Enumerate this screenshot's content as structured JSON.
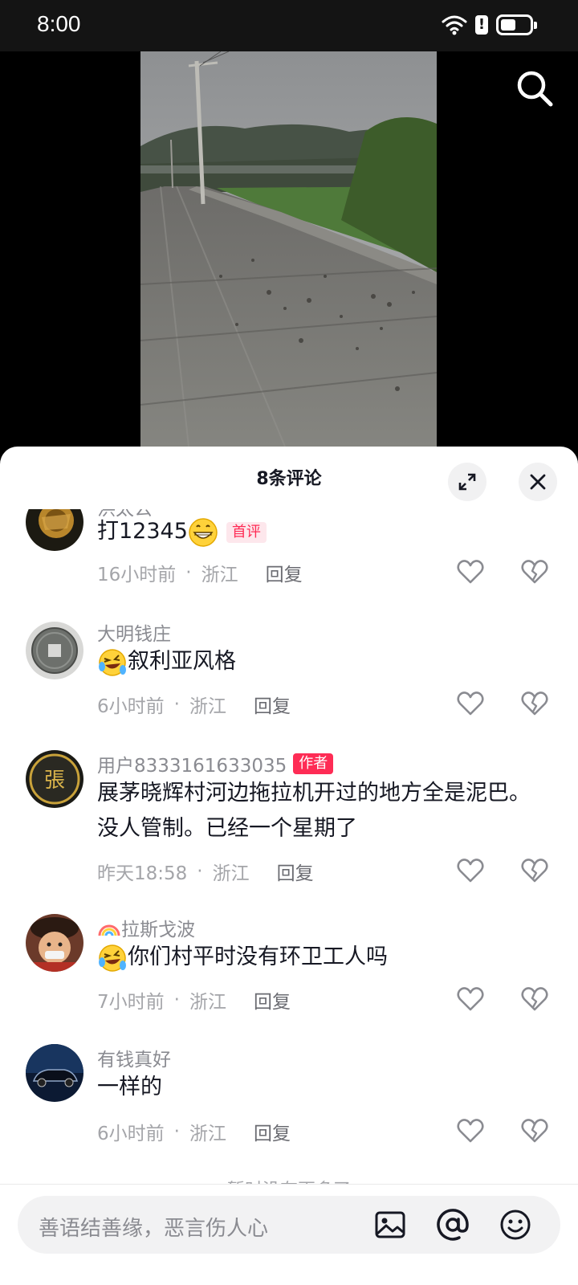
{
  "status_bar": {
    "time": "8:00"
  },
  "sheet": {
    "title": "8条评论",
    "no_more": "暂时没有更多了"
  },
  "comments": [
    {
      "user": "洪太公",
      "text": "打12345",
      "tag": "首评",
      "time": "16小时前",
      "location": "浙江",
      "reply": "回复"
    },
    {
      "user": "大明钱庄",
      "text": "叙利亚风格",
      "time": "6小时前",
      "location": "浙江",
      "reply": "回复"
    },
    {
      "user": "用户8333161633035",
      "tag": "作者",
      "text": "展茅晓辉村河边拖拉机开过的地方全是泥巴。没人管制。已经一个星期了",
      "time": "昨天18:58",
      "location": "浙江",
      "reply": "回复"
    },
    {
      "user": "拉斯戈波",
      "text": "你们村平时没有环卫工人吗",
      "time": "7小时前",
      "location": "浙江",
      "reply": "回复"
    },
    {
      "user": "有钱真好",
      "text": "一样的",
      "time": "6小时前",
      "location": "浙江",
      "reply": "回复"
    }
  ],
  "meta_separator": "·",
  "input": {
    "placeholder": "善语结善缘，恶言伤人心"
  },
  "colors": {
    "accent": "#fe2c55",
    "text": "#161823",
    "muted": "#8a8b91"
  }
}
